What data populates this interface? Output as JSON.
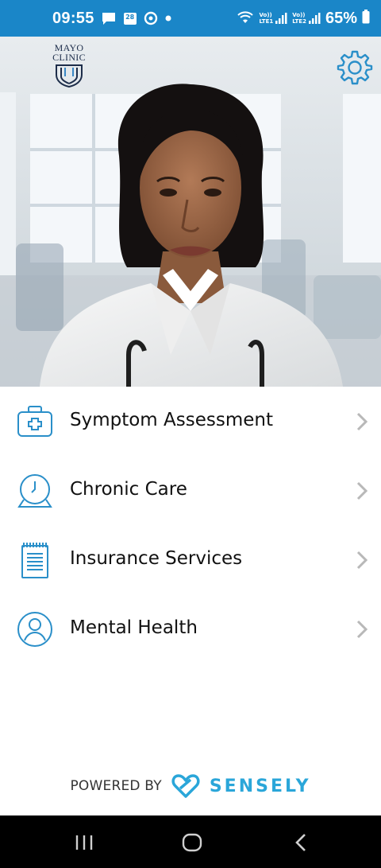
{
  "status_bar": {
    "time": "09:55",
    "battery": "65%",
    "calendar_day": "28",
    "sim1": "LTE1",
    "sim2": "LTE2",
    "volte": "Vo))"
  },
  "header": {
    "logo_line1": "MAYO",
    "logo_line2": "CLINIC",
    "settings_icon": "gear-icon"
  },
  "menu": {
    "items": [
      {
        "label": "Symptom Assessment",
        "icon": "medical-kit-icon"
      },
      {
        "label": "Chronic Care",
        "icon": "clock-icon"
      },
      {
        "label": "Insurance Services",
        "icon": "document-icon"
      },
      {
        "label": "Mental Health",
        "icon": "person-icon"
      }
    ]
  },
  "footer": {
    "powered_by": "POWERED BY",
    "brand": "SENSELY"
  },
  "colors": {
    "status_bar": "#1a86c8",
    "icon_blue": "#2a8fc9",
    "brand_blue": "#2aa6d9",
    "chevron": "#b8b8b8"
  }
}
